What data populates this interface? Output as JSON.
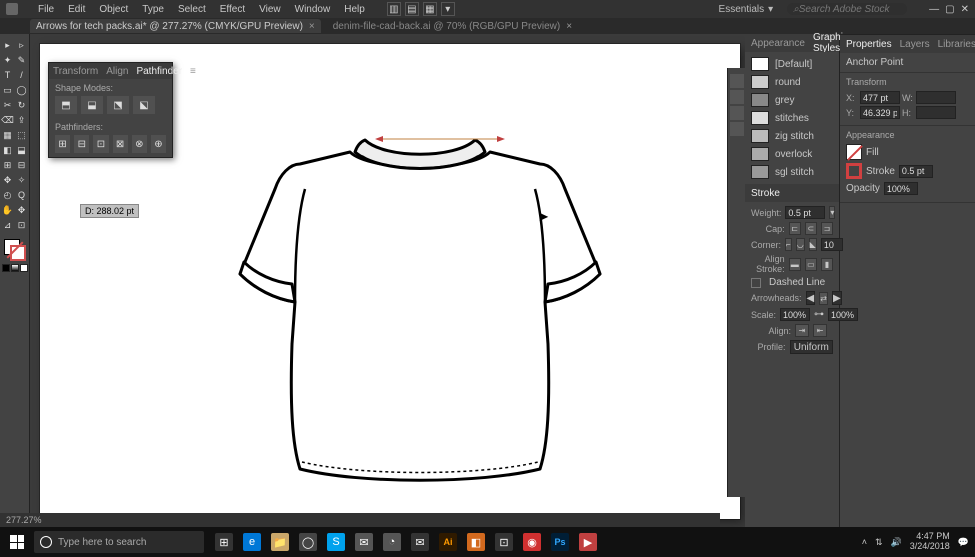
{
  "menu": {
    "items": [
      "File",
      "Edit",
      "Object",
      "Type",
      "Select",
      "Effect",
      "View",
      "Window",
      "Help"
    ]
  },
  "workspace": {
    "label": "Essentials"
  },
  "search_hint": "Search Adobe Stock",
  "tabs": [
    {
      "label": "Arrows for tech packs.ai* @ 277.27% (CMYK/GPU Preview)",
      "active": true
    },
    {
      "label": "denim-file-cad-back.ai @ 70% (RGB/GPU Preview)",
      "active": false
    }
  ],
  "tools": [
    [
      "▸",
      "▹"
    ],
    [
      "✦",
      "✎"
    ],
    [
      "T",
      "/"
    ],
    [
      "▭",
      "◯"
    ],
    [
      "✂",
      "↻"
    ],
    [
      "⌫",
      "⇪"
    ],
    [
      "▦",
      "⬚"
    ],
    [
      "◧",
      "⬓"
    ],
    [
      "⊞",
      "⊟"
    ],
    [
      "✥",
      "✧"
    ],
    [
      "◴",
      "Q"
    ],
    [
      "✋",
      "✥"
    ],
    [
      "⊿",
      "⊡"
    ]
  ],
  "swatches_small": [
    "#000000",
    "#ffffff",
    "#888888"
  ],
  "dim_badge": "D: 288.02 pt",
  "pathfinder": {
    "tabs": [
      "Transform",
      "Align",
      "Pathfinder"
    ],
    "active": "Pathfinder",
    "section1": "Shape Modes:",
    "section2": "Pathfinders:",
    "shape_modes": [
      "⬒",
      "⬓",
      "⬔",
      "⬕"
    ],
    "pathfinders": [
      "⊞",
      "⊟",
      "⊡",
      "⊠",
      "⊗",
      "⊕"
    ]
  },
  "graphic_styles": {
    "tabs": [
      "Appearance",
      "Graphic Styles"
    ],
    "active": "Graphic Styles",
    "items": [
      {
        "name": "[Default]",
        "color": "#ffffff"
      },
      {
        "name": "round",
        "color": "#cccccc"
      },
      {
        "name": "grey",
        "color": "#888888"
      },
      {
        "name": "stitches",
        "color": "#dddddd"
      },
      {
        "name": "zig stitch",
        "color": "#bbbbbb"
      },
      {
        "name": "overlock",
        "color": "#aaaaaa"
      },
      {
        "name": "sgl stitch",
        "color": "#999999"
      }
    ]
  },
  "stroke": {
    "tab": "Stroke",
    "weight_lab": "Weight:",
    "weight": "0.5 pt",
    "cap_lab": "Cap:",
    "corner_lab": "Corner:",
    "limit": "10",
    "align_lab": "Align Stroke:",
    "dashed": "Dashed Line",
    "arrow_lab": "Arrowheads:",
    "scale_lab": "Scale:",
    "scale1": "100%",
    "scale2": "100%",
    "align2_lab": "Align:",
    "profile_lab": "Profile:",
    "profile": "Uniform"
  },
  "properties": {
    "tabs": [
      "Properties",
      "Layers",
      "Libraries"
    ],
    "active": "Properties",
    "object_type": "Anchor Point",
    "transform_hd": "Transform",
    "x_lab": "X:",
    "x": "477 pt",
    "y_lab": "Y:",
    "y": "46.329 pt",
    "w_lab": "W:",
    "w": "",
    "h_lab": "H:",
    "h": "",
    "appearance_hd": "Appearance",
    "fill_lab": "Fill",
    "stroke_lab": "Stroke",
    "stroke_w": "0.5 pt",
    "opacity_lab": "Opacity",
    "opacity": "100%"
  },
  "status": "277.27%",
  "taskbar": {
    "search": "Type here to search",
    "apps": [
      {
        "glyph": "⊞",
        "bg": "#333333"
      },
      {
        "glyph": "e",
        "bg": "#0078d7"
      },
      {
        "glyph": "📁",
        "bg": "#caa76a"
      },
      {
        "glyph": "◯",
        "bg": "#444444"
      },
      {
        "glyph": "S",
        "bg": "#00a2ed"
      },
      {
        "glyph": "✉",
        "bg": "#555555"
      },
      {
        "glyph": "◔",
        "bg": "#555555"
      },
      {
        "glyph": "✉",
        "bg": "#333333"
      },
      {
        "glyph": "Ai",
        "bg": "#2f1a00"
      },
      {
        "glyph": "◧",
        "bg": "#d2691e"
      },
      {
        "glyph": "⊡",
        "bg": "#333333"
      },
      {
        "glyph": "◉",
        "bg": "#d03030"
      },
      {
        "glyph": "Ps",
        "bg": "#001e36"
      },
      {
        "glyph": "▶",
        "bg": "#c04040"
      }
    ],
    "time": "4:47 PM",
    "date": "3/24/2018"
  }
}
